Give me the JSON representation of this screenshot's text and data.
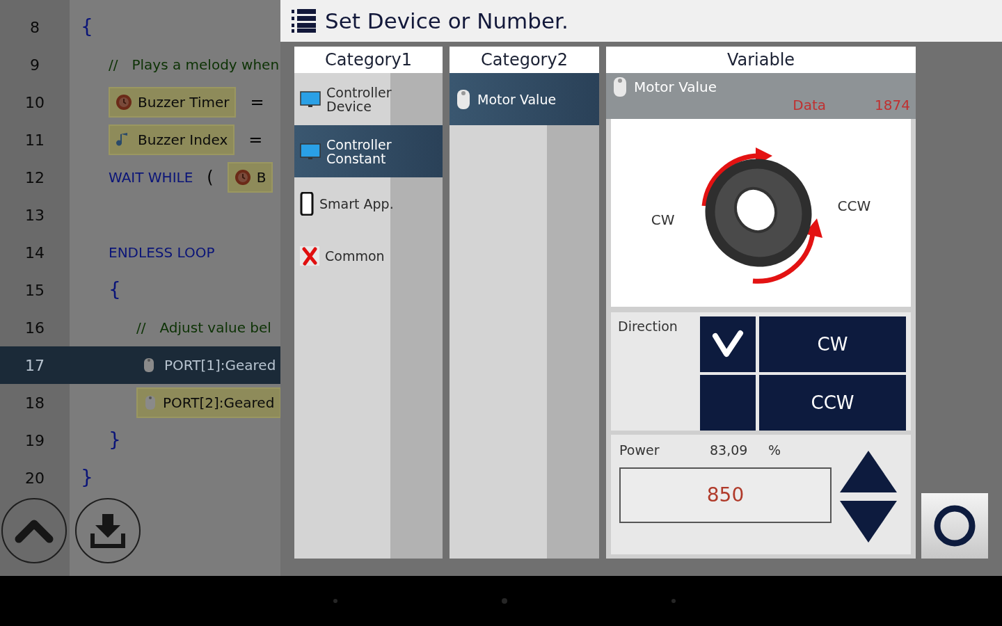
{
  "editor": {
    "lines": [
      {
        "number": "8",
        "selected": false,
        "parts": [
          {
            "kind": "brace",
            "text": "{"
          }
        ],
        "children": [
          {
            "number": "9",
            "selected": false,
            "parts": [
              {
                "kind": "comment",
                "text": "//"
              },
              {
                "kind": "comment",
                "text": "Plays a melody when"
              }
            ]
          },
          {
            "number": "10",
            "selected": false,
            "parts": [
              {
                "kind": "timer-block",
                "text": "Buzzer Timer"
              },
              {
                "kind": "op",
                "text": "="
              }
            ]
          },
          {
            "number": "11",
            "selected": false,
            "parts": [
              {
                "kind": "note-block",
                "text": "Buzzer Index"
              },
              {
                "kind": "op",
                "text": "="
              }
            ]
          },
          {
            "number": "12",
            "selected": false,
            "parts": [
              {
                "kind": "keyword",
                "text": "WAIT WHILE"
              },
              {
                "kind": "op",
                "text": "("
              },
              {
                "kind": "timer-block",
                "text": "B"
              }
            ]
          },
          {
            "number": "13",
            "selected": false
          },
          {
            "number": "14",
            "selected": false,
            "parts": [
              {
                "kind": "keyword",
                "text": "ENDLESS LOOP"
              }
            ]
          },
          {
            "number": "15",
            "selected": false,
            "parts": [
              {
                "kind": "brace",
                "text": "{"
              }
            ],
            "children": [
              {
                "number": "16",
                "selected": false,
                "parts": [
                  {
                    "kind": "comment",
                    "text": "//"
                  },
                  {
                    "kind": "comment",
                    "text": "Adjust value bel"
                  }
                ]
              },
              {
                "number": "17",
                "selected": true,
                "parts": [
                  {
                    "kind": "motor-plain",
                    "text": "PORT[1]:Geared"
                  }
                ]
              },
              {
                "number": "18",
                "selected": false,
                "parts": [
                  {
                    "kind": "motor-block",
                    "text": "PORT[2]:Geared"
                  }
                ]
              }
            ]
          },
          {
            "number": "19",
            "selected": false,
            "parts": [
              {
                "kind": "brace",
                "text": "}"
              }
            ]
          }
        ]
      },
      {
        "number": "20",
        "selected": false,
        "parts": [
          {
            "kind": "brace",
            "text": "}"
          }
        ]
      }
    ]
  },
  "dialog": {
    "title": "Set Device or Number.",
    "category1": {
      "heading": "Category1",
      "items": [
        {
          "label": "Controller Device",
          "kind": "monitor",
          "selected": false
        },
        {
          "label": "Controller Constant",
          "kind": "monitor",
          "selected": true
        },
        {
          "label": "Smart App.",
          "kind": "phone",
          "selected": false
        },
        {
          "label": "Common",
          "kind": "cross",
          "selected": false
        }
      ]
    },
    "category2": {
      "heading": "Category2",
      "items": [
        {
          "label": "Motor Value",
          "kind": "motor",
          "selected": true
        }
      ]
    },
    "variable": {
      "heading": "Variable",
      "name": "Motor Value",
      "data_label": "Data",
      "data_value": "1874",
      "cw_label": "CW",
      "ccw_label": "CCW",
      "direction": {
        "label": "Direction",
        "options": [
          {
            "label": "CW",
            "selected": true
          },
          {
            "label": "CCW",
            "selected": false
          }
        ]
      },
      "power": {
        "label": "Power",
        "percent": "83,09",
        "unit": "%",
        "value": "850"
      }
    }
  }
}
